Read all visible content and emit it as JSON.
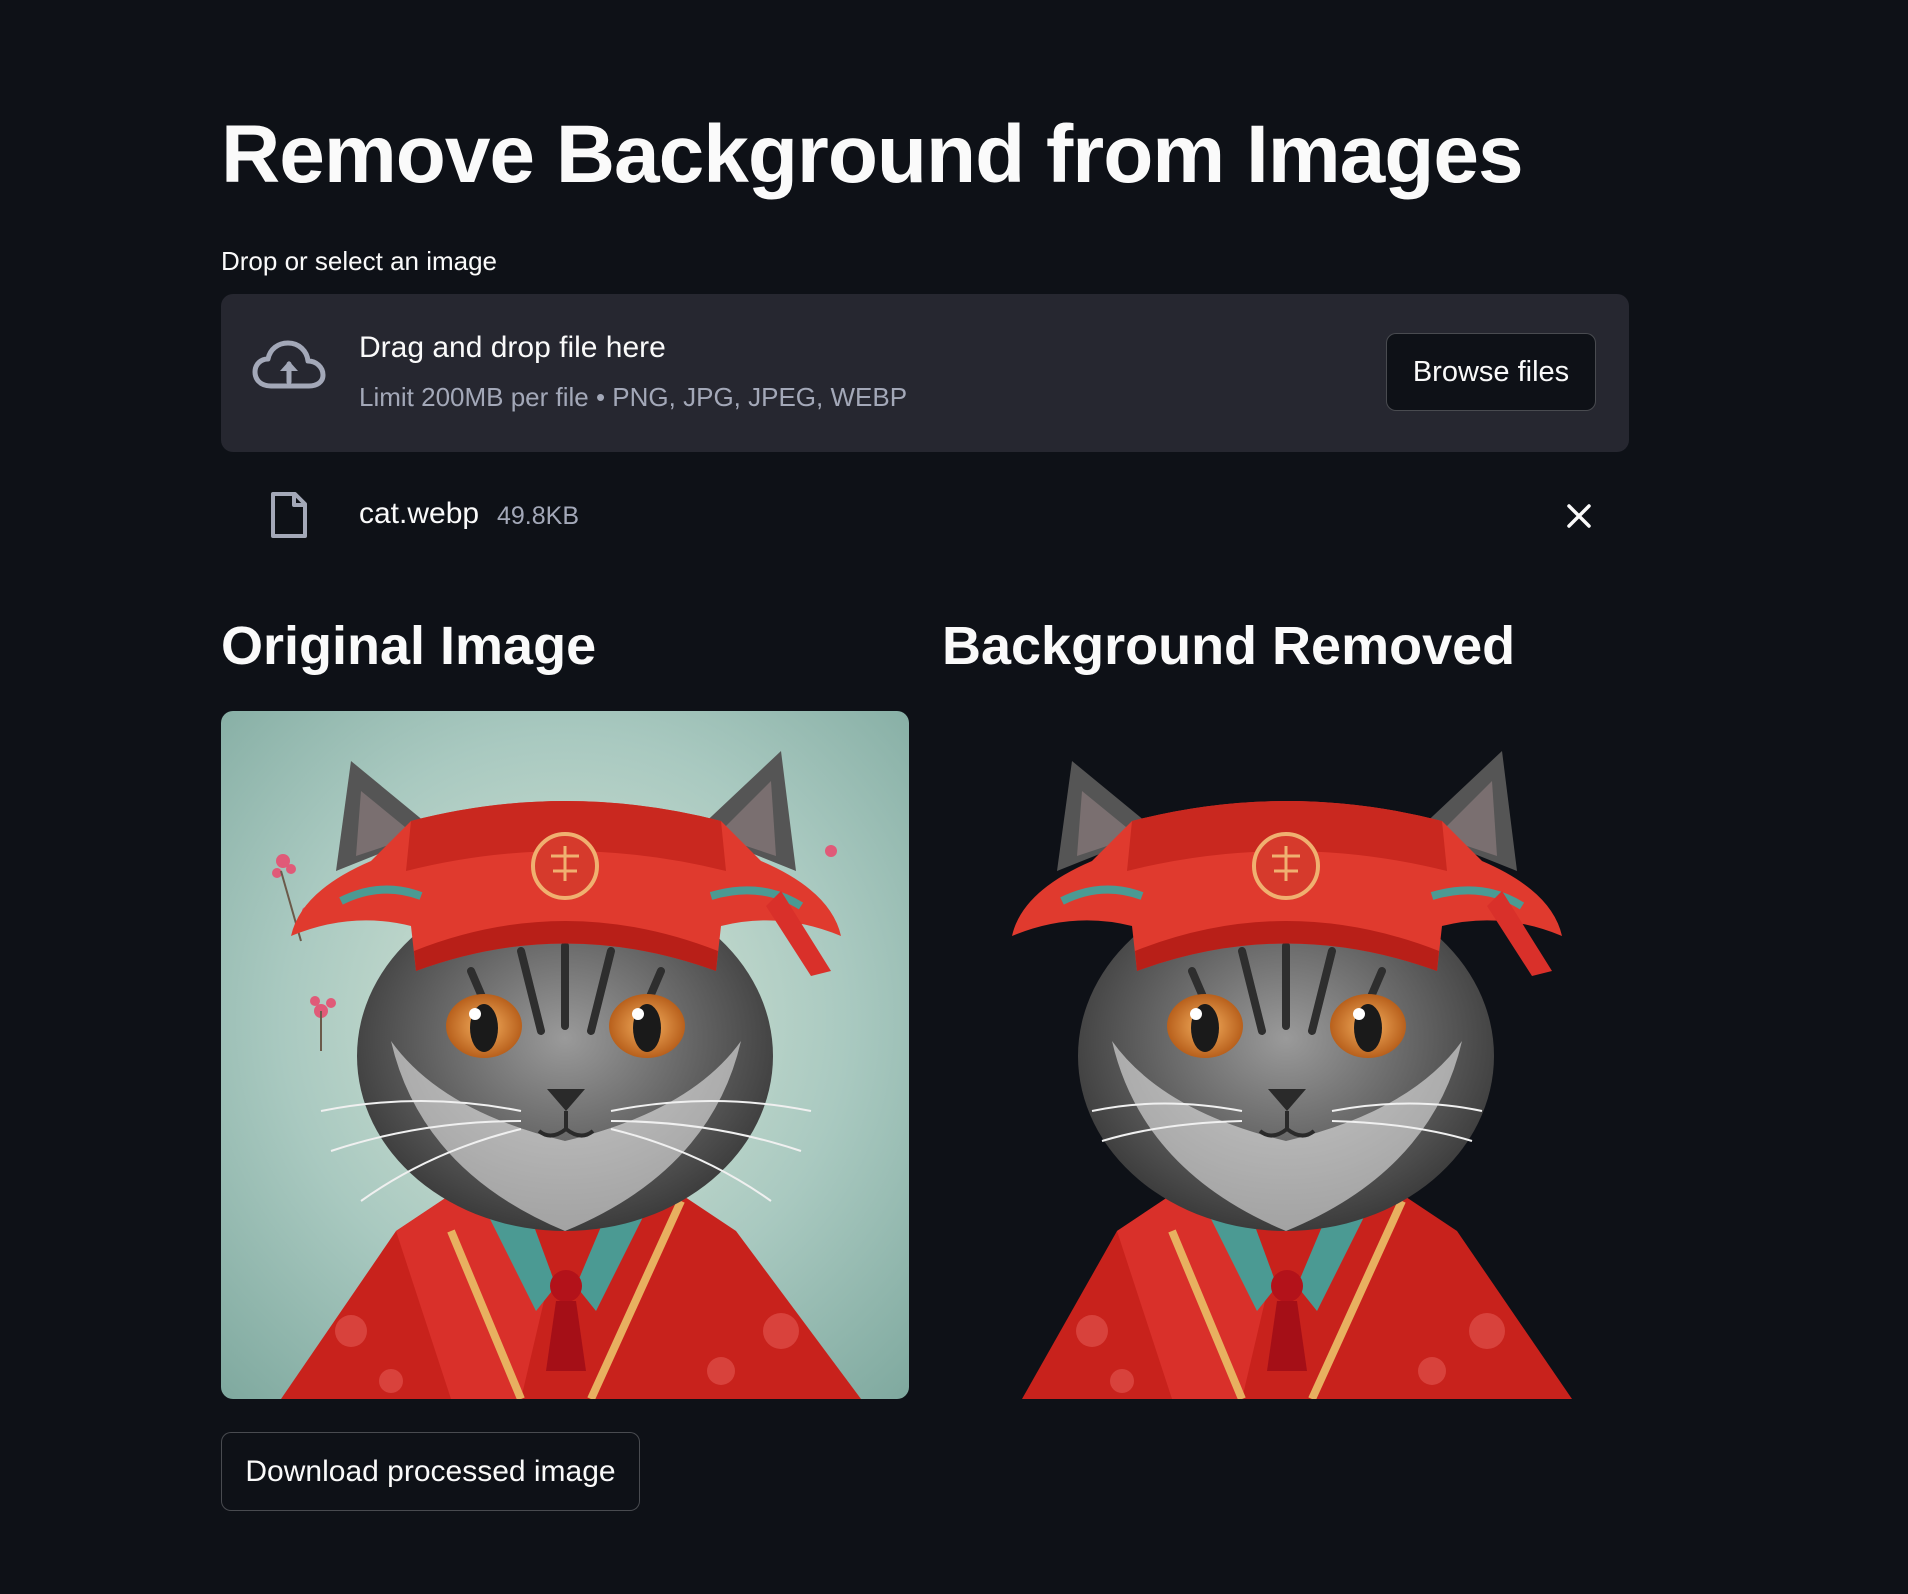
{
  "page": {
    "title": "Remove Background from Images"
  },
  "uploader": {
    "label": "Drop or select an image",
    "drop_text": "Drag and drop file here",
    "limit_text": "Limit 200MB per file • PNG, JPG, JPEG, WEBP",
    "browse_label": "Browse files",
    "icon": "cloud-upload-icon"
  },
  "uploaded_file": {
    "name": "cat.webp",
    "size": "49.8KB",
    "icon": "file-icon",
    "remove_icon": "close-icon"
  },
  "columns": {
    "original_heading": "Original Image",
    "removed_heading": "Background Removed"
  },
  "images": {
    "original_alt": "Cat in red hat and robe with teal background",
    "removed_alt": "Cat in red hat and robe with background removed"
  },
  "actions": {
    "download_label": "Download processed image"
  },
  "colors": {
    "background": "#0e1117",
    "dropzone": "#262730",
    "text": "#fafafa",
    "muted_text": "#a3a8b8"
  }
}
